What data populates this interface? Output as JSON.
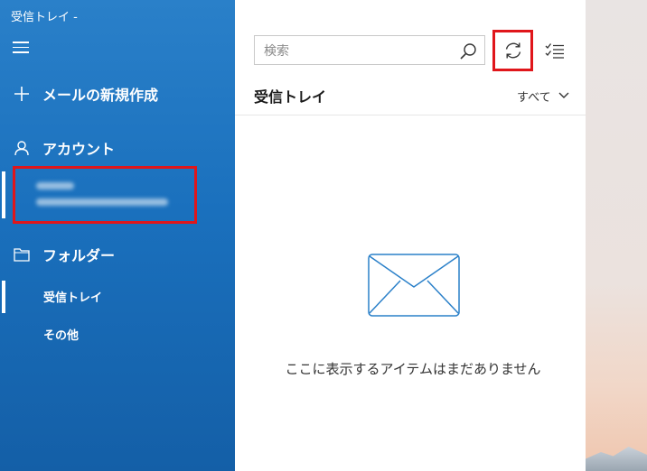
{
  "window": {
    "title": "受信トレイ -"
  },
  "sidebar": {
    "compose_label": "メールの新規作成",
    "accounts_label": "アカウント",
    "folders_label": "フォルダー",
    "folders": [
      {
        "label": "受信トレイ",
        "selected": true
      },
      {
        "label": "その他",
        "selected": false
      }
    ]
  },
  "list": {
    "search": {
      "placeholder": "検索"
    },
    "folder_title": "受信トレイ",
    "filter_label": "すべて",
    "empty_message": "ここに表示するアイテムはまだありません"
  },
  "colors": {
    "sidebar": "#1a70bd",
    "highlight": "#e0161b",
    "accent": "#2a80c9"
  }
}
